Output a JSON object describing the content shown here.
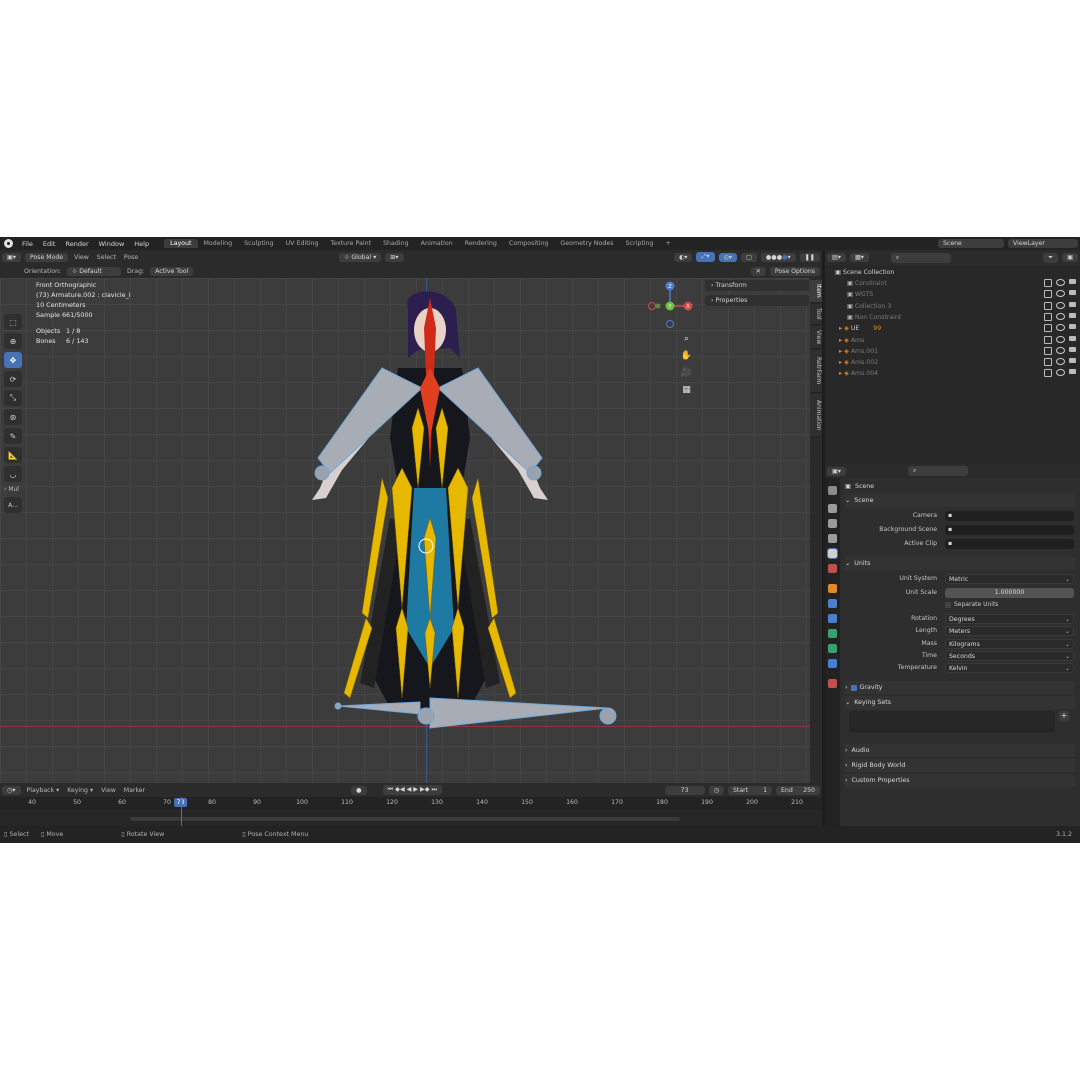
{
  "menubar": {
    "items": [
      "File",
      "Edit",
      "Render",
      "Window",
      "Help"
    ],
    "workspaces": [
      "Layout",
      "Modeling",
      "Sculpting",
      "UV Editing",
      "Texture Paint",
      "Shading",
      "Animation",
      "Rendering",
      "Compositing",
      "Geometry Nodes",
      "Scripting"
    ],
    "active_workspace": "Layout",
    "add_tab": "+",
    "scene_label": "Scene",
    "view_layer_label": "ViewLayer"
  },
  "viewport": {
    "mode": "Pose Mode",
    "menus": [
      "View",
      "Select",
      "Pose"
    ],
    "transform_orientation": "Global",
    "orientation_label": "Orientation:",
    "orientation_value": "Default",
    "drag_label": "Drag:",
    "drag_value": "Active Tool",
    "pose_options": "Pose Options",
    "overlay": {
      "view_name": "Front Orthographic",
      "object_name": "(73) Armature.002 : clavicle_l",
      "scale": "10 Centimeters",
      "sample": "Sample 661/5000",
      "objects_label": "Objects",
      "objects_value": "1 / 8",
      "bones_label": "Bones",
      "bones_value": "6 / 143"
    },
    "npanel": {
      "sections": [
        "Transform",
        "Properties"
      ],
      "tabs": [
        "Item",
        "Tool",
        "View",
        "RetrFarm",
        "Animation"
      ]
    },
    "gizmo": {
      "x": "X",
      "y": "Y",
      "z": "Z"
    },
    "toolbar_extra": "Mul",
    "toolbar_extra2": "A..."
  },
  "timeline": {
    "menus": [
      "Playback",
      "Keying",
      "View",
      "Marker"
    ],
    "ruler_ticks": [
      40,
      50,
      60,
      70,
      80,
      90,
      100,
      110,
      120,
      130,
      140,
      150,
      160,
      170,
      180,
      190,
      200,
      210
    ],
    "current_frame": "73",
    "start_label": "Start",
    "start_value": "1",
    "end_label": "End",
    "end_value": "250"
  },
  "statusbar": {
    "select": "Select",
    "move": "Move",
    "rotate_view": "Rotate View",
    "context_menu": "Pose Context Menu",
    "version": "3.1.2"
  },
  "outliner": {
    "root": "Scene Collection",
    "rows": [
      {
        "name": "Constraint",
        "dim": true
      },
      {
        "name": "WGTS",
        "dim": true
      },
      {
        "name": "Collection 3",
        "dim": true
      },
      {
        "name": "Non Constraint",
        "dim": true
      },
      {
        "name": "UE",
        "dim": false
      },
      {
        "name": "Ams",
        "dim": true
      },
      {
        "name": "Ams.001",
        "dim": true
      },
      {
        "name": "Ams.002",
        "dim": true
      },
      {
        "name": "Ams.004",
        "dim": true
      }
    ],
    "ue_badge": "99"
  },
  "properties": {
    "context": "Scene",
    "scene_section": "Scene",
    "camera_label": "Camera",
    "background_scene_label": "Background Scene",
    "active_clip_label": "Active Clip",
    "units_section": "Units",
    "unit_system_label": "Unit System",
    "unit_system_value": "Metric",
    "unit_scale_label": "Unit Scale",
    "unit_scale_value": "1.000000",
    "separate_units": "Separate Units",
    "rotation_label": "Rotation",
    "rotation_value": "Degrees",
    "length_label": "Length",
    "length_value": "Meters",
    "mass_label": "Mass",
    "mass_value": "Kilograms",
    "time_label": "Time",
    "time_value": "Seconds",
    "temperature_label": "Temperature",
    "temperature_value": "Kelvin",
    "gravity_section": "Gravity",
    "keying_sets_section": "Keying Sets",
    "audio_section": "Audio",
    "rigid_body_section": "Rigid Body World",
    "custom_props_section": "Custom Properties"
  },
  "colors": {
    "accent": "#4772b3",
    "bone_yellow": "#e6b800",
    "bone_gray": "#a8acb4",
    "bone_red": "#d02a1a"
  }
}
